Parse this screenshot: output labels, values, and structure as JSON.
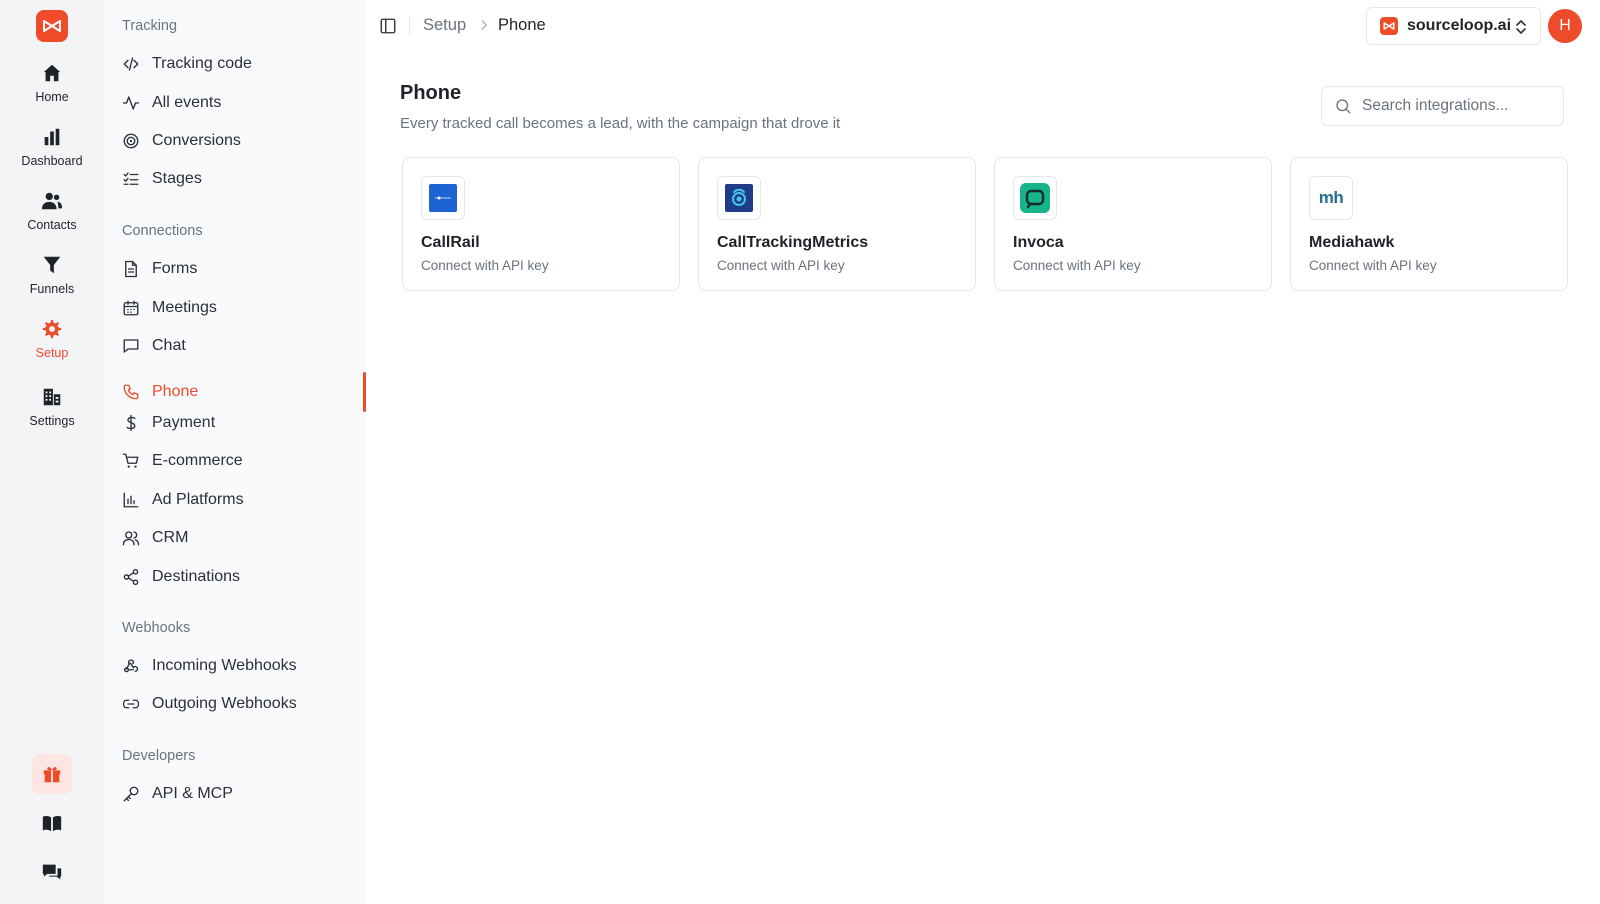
{
  "rail": {
    "items": [
      {
        "label": "Home",
        "icon": "home-icon"
      },
      {
        "label": "Dashboard",
        "icon": "bar-chart-icon"
      },
      {
        "label": "Contacts",
        "icon": "users-icon"
      },
      {
        "label": "Funnels",
        "icon": "funnel-icon"
      },
      {
        "label": "Setup",
        "icon": "gear-icon",
        "active": true
      },
      {
        "label": "Settings",
        "icon": "building-icon"
      }
    ],
    "bottom": [
      "gift-icon",
      "book-icon",
      "chat-bubbles-icon"
    ]
  },
  "subnav": {
    "sections": [
      {
        "title": "Tracking",
        "items": [
          "Tracking code",
          "All events",
          "Conversions",
          "Stages"
        ]
      },
      {
        "title": "Connections",
        "items": [
          "Forms",
          "Meetings",
          "Chat",
          "Phone",
          "Payment",
          "E-commerce",
          "Ad Platforms",
          "CRM",
          "Destinations"
        ]
      },
      {
        "title": "Webhooks",
        "items": [
          "Incoming Webhooks",
          "Outgoing Webhooks"
        ]
      },
      {
        "title": "Developers",
        "items": [
          "API & MCP"
        ]
      }
    ],
    "active": "Phone"
  },
  "topbar": {
    "breadcrumb": [
      "Setup",
      "Phone"
    ],
    "workspace": "sourceloop.ai",
    "avatar_initial": "H"
  },
  "main": {
    "title": "Phone",
    "subtitle": "Every tracked call becomes a lead, with the campaign that drove it",
    "search_placeholder": "Search integrations...",
    "integrations": [
      {
        "name": "CallRail",
        "desc": "Connect with API key",
        "icon": "callrail-logo"
      },
      {
        "name": "CallTrackingMetrics",
        "desc": "Connect with API key",
        "icon": "calltrackingmetrics-logo"
      },
      {
        "name": "Invoca",
        "desc": "Connect with API key",
        "icon": "invoca-logo"
      },
      {
        "name": "Mediahawk",
        "desc": "Connect with API key",
        "icon": "mediahawk-logo",
        "logo_text": "mh"
      }
    ]
  },
  "colors": {
    "accent": "#ee4b2b",
    "muted": "#6b7280",
    "border": "#e5e7eb"
  }
}
